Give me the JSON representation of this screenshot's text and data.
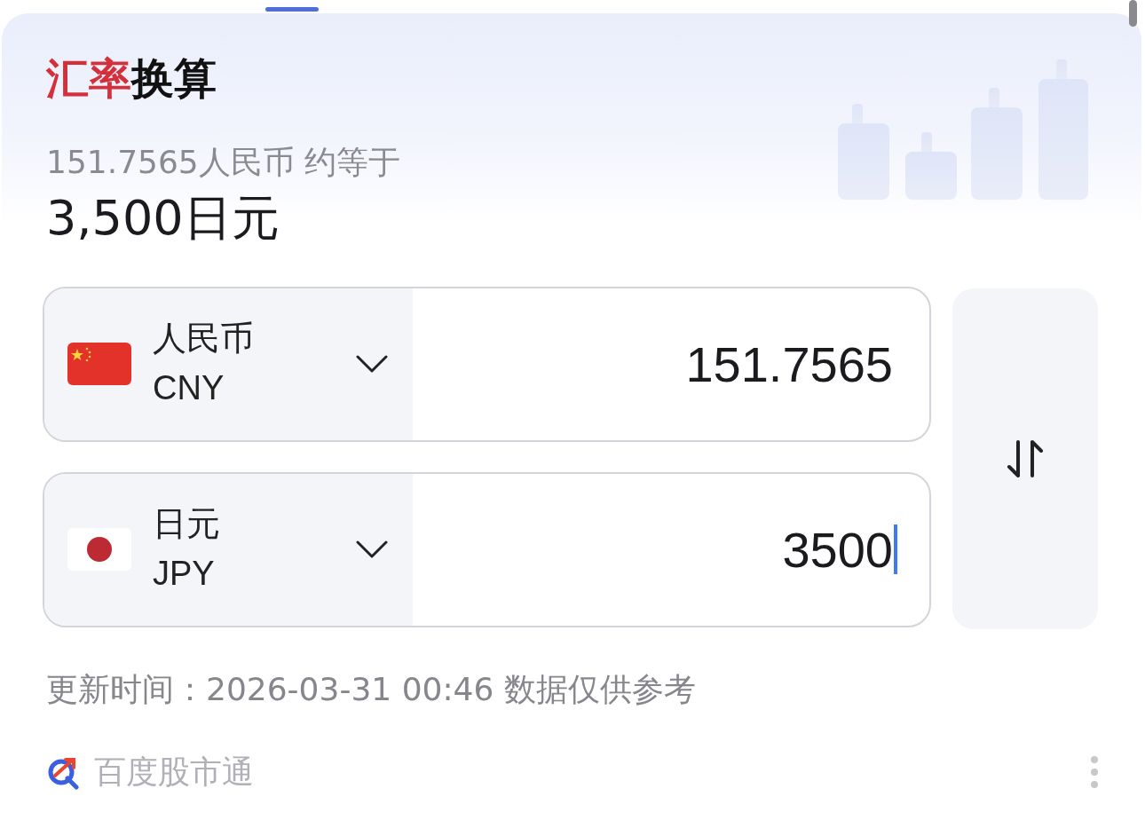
{
  "title": {
    "accent": "汇率",
    "rest": "换算"
  },
  "summary": "151.7565人民币 约等于",
  "result": "3,500日元",
  "currencies": [
    {
      "kind": "cn",
      "name": "人民币",
      "code": "CNY",
      "value": "151.7565",
      "focused": false
    },
    {
      "kind": "jp",
      "name": "日元",
      "code": "JPY",
      "value": "3500",
      "focused": true
    }
  ],
  "update_note": "更新时间：2026-03-31 00:46 数据仅供参考",
  "source": "百度股市通"
}
